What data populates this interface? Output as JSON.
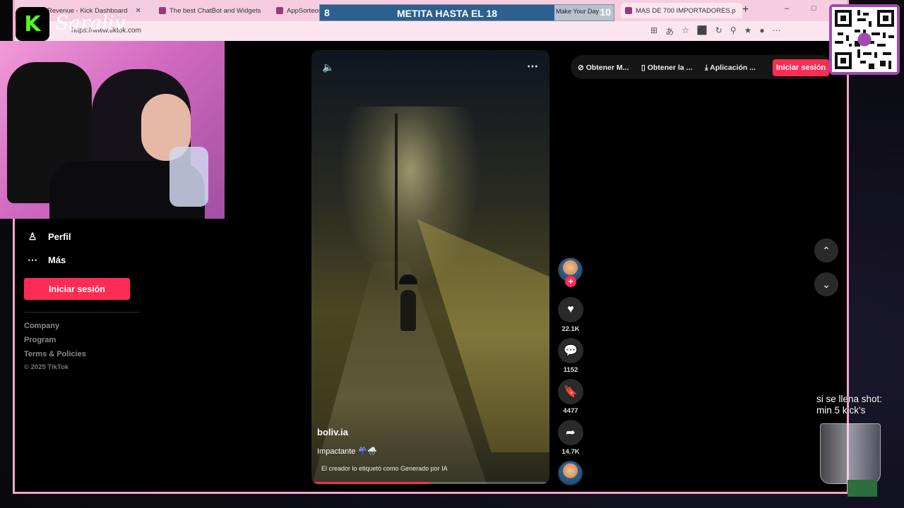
{
  "browser": {
    "tabs": [
      {
        "label": "Revenue - Kick Dashboard"
      },
      {
        "label": "The best ChatBot and Widgets"
      },
      {
        "label": "AppSorteos"
      },
      {
        "label": "Make Your Day"
      },
      {
        "label": "MAS DE 700 IMPORTADORES.p"
      }
    ],
    "new_tab": "+",
    "minimize": "–",
    "maximize": "□",
    "url": "https://www.tiktok.com"
  },
  "stream_overlay": {
    "goal_current": "8",
    "goal_title": "METITA HASTA EL 18",
    "goal_target": "10",
    "kick_logo": "K",
    "streamer_name": "Saraliv"
  },
  "sidebar": {
    "items": [
      {
        "label": "Perfil",
        "icon": "person-icon"
      },
      {
        "label": "Más",
        "icon": "more-icon"
      }
    ],
    "login_button": "Iniciar sesión",
    "footer_links": [
      "Company",
      "Program",
      "Terms & Policies"
    ],
    "copyright": "© 2025 TikTok"
  },
  "video": {
    "author": "boliv.ia",
    "caption": "Impactante ☔🌧️",
    "ai_label": "El creador lo etiquetó como Generado por IA",
    "progress": 0.5
  },
  "actions": {
    "likes": "22.1K",
    "comments": "1152",
    "saves": "4477",
    "shares": "14.7K"
  },
  "header": {
    "items": [
      {
        "label": "Obtener M...",
        "icon": "coin-icon"
      },
      {
        "label": "Obtener la ...",
        "icon": "phone-icon"
      },
      {
        "label": "Aplicación ...",
        "icon": "download-icon"
      }
    ],
    "login_button": "Iniciar sesión"
  },
  "glass_overlay": {
    "line1": "si se llena shot:",
    "line2": "min 5 kick's"
  },
  "colors": {
    "tiktok_red": "#fe2c55",
    "frame_pink": "#f4a6c8",
    "kick_green": "#53fc18"
  }
}
